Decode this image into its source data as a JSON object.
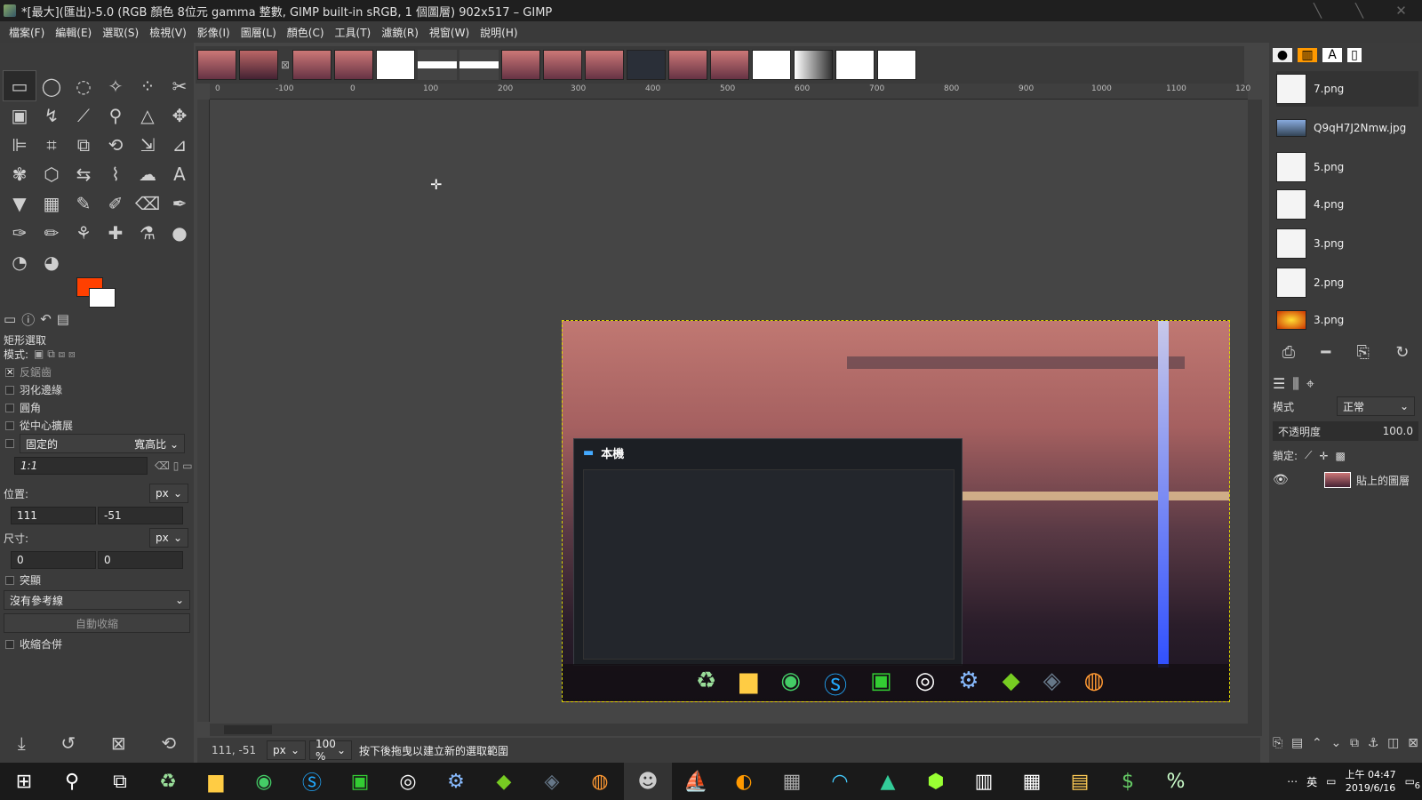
{
  "window": {
    "title": "*[最大](匯出)-5.0 (RGB 顏色 8位元 gamma 整數, GIMP built-in sRGB, 1 個圖層) 902x517 – GIMP"
  },
  "menu": [
    "檔案(F)",
    "編輯(E)",
    "選取(S)",
    "檢視(V)",
    "影像(I)",
    "圖層(L)",
    "顏色(C)",
    "工具(T)",
    "濾鏡(R)",
    "視窗(W)",
    "說明(H)"
  ],
  "colors": {
    "foreground": "#ff4000",
    "background": "#ffffff",
    "accent": "#ddd800"
  },
  "tool_options": {
    "title": "矩形選取",
    "mode_label": "模式:",
    "antialias": "反鋸齒",
    "feather": "羽化邊緣",
    "rounded": "圓角",
    "expand_center": "從中心擴展",
    "fixed": "固定的",
    "fixed_type": "寬高比",
    "ratio": "1:1",
    "position_label": "位置:",
    "position_unit": "px",
    "pos_x": "111",
    "pos_y": "-51",
    "size_label": "尺寸:",
    "size_unit": "px",
    "size_w": "0",
    "size_h": "0",
    "highlight": "突顯",
    "guides": "沒有參考線",
    "auto_shrink": "自動收縮",
    "shrink_merged": "收縮合併"
  },
  "ruler": {
    "h_labels": [
      "0",
      "-100",
      "0",
      "100",
      "200",
      "300",
      "400",
      "500",
      "600",
      "700",
      "800",
      "900",
      "1000",
      "1100",
      "120"
    ]
  },
  "explorer": {
    "title": "本機"
  },
  "status": {
    "coords": "111, -51",
    "unit": "px",
    "zoom": "100 %",
    "message": "按下後拖曳以建立新的選取範圍"
  },
  "brushes": [
    "7.png",
    "Q9qH7J2Nmw.jpg",
    "5.png",
    "4.png",
    "3.png",
    "2.png",
    "3.png"
  ],
  "layers": {
    "mode_label": "模式",
    "mode_value": "正常",
    "opacity_label": "不透明度",
    "opacity_value": "100.0",
    "lock_label": "鎖定:",
    "layer_name": "貼上的圖層"
  },
  "taskbar": {
    "ime": "英",
    "time": "上午 04:47",
    "date": "2019/6/16",
    "notif_count": "6"
  }
}
